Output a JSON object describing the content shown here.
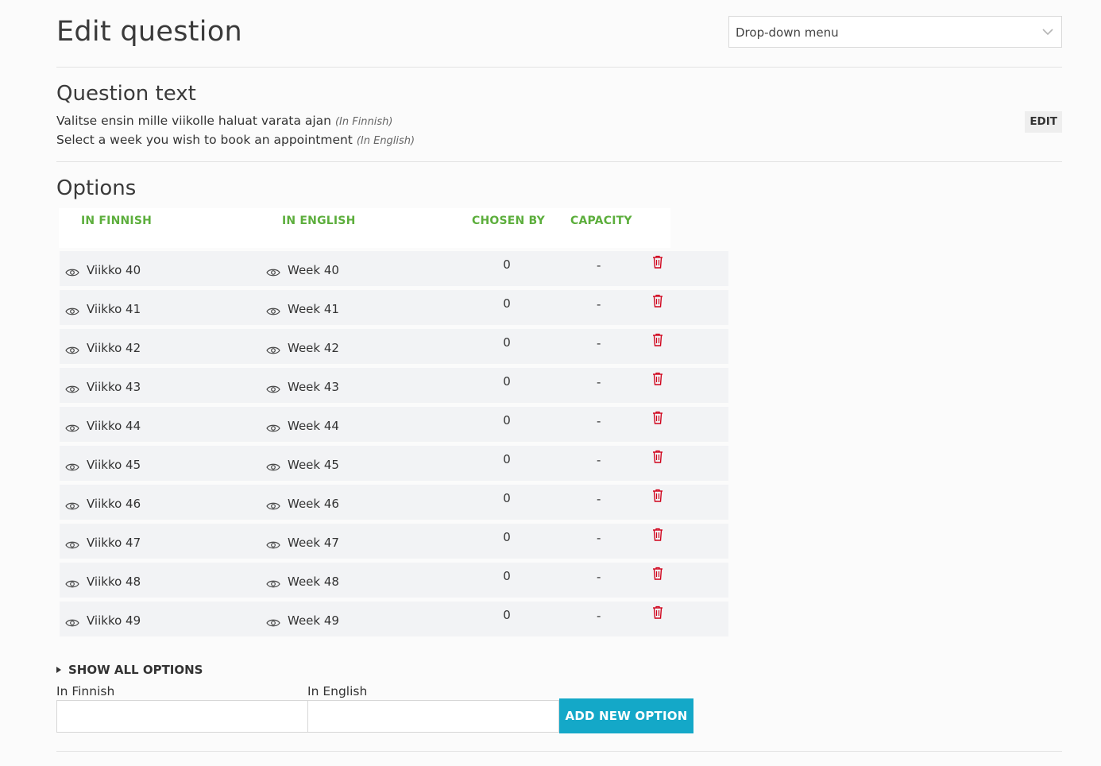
{
  "header": {
    "title": "Edit question",
    "question_type": "Drop-down menu"
  },
  "question_text": {
    "title": "Question text",
    "finnish": "Valitse ensin mille viikolle haluat varata ajan",
    "finnish_tag": "(In Finnish)",
    "english": "Select a week you wish to book an appointment",
    "english_tag": "(In English)",
    "edit_label": "EDIT"
  },
  "options": {
    "title": "Options",
    "columns": {
      "finnish": "IN FINNISH",
      "english": "IN ENGLISH",
      "chosen_by": "CHOSEN BY",
      "capacity": "CAPACITY"
    },
    "rows": [
      {
        "fi": "Viikko 40",
        "en": "Week 40",
        "chosen": "0",
        "capacity": "-"
      },
      {
        "fi": "Viikko 41",
        "en": "Week 41",
        "chosen": "0",
        "capacity": "-"
      },
      {
        "fi": "Viikko 42",
        "en": "Week 42",
        "chosen": "0",
        "capacity": "-"
      },
      {
        "fi": "Viikko 43",
        "en": "Week 43",
        "chosen": "0",
        "capacity": "-"
      },
      {
        "fi": "Viikko 44",
        "en": "Week 44",
        "chosen": "0",
        "capacity": "-"
      },
      {
        "fi": "Viikko 45",
        "en": "Week 45",
        "chosen": "0",
        "capacity": "-"
      },
      {
        "fi": "Viikko 46",
        "en": "Week 46",
        "chosen": "0",
        "capacity": "-"
      },
      {
        "fi": "Viikko 47",
        "en": "Week 47",
        "chosen": "0",
        "capacity": "-"
      },
      {
        "fi": "Viikko 48",
        "en": "Week 48",
        "chosen": "0",
        "capacity": "-"
      },
      {
        "fi": "Viikko 49",
        "en": "Week 49",
        "chosen": "0",
        "capacity": "-"
      }
    ],
    "show_all_label": "SHOW ALL OPTIONS"
  },
  "new_option": {
    "finnish_label": "In Finnish",
    "english_label": "In English",
    "finnish_value": "",
    "english_value": "",
    "add_label": "ADD NEW OPTION"
  },
  "colors": {
    "accent_green": "#5cae3c",
    "button_blue": "#14a8c8",
    "delete_red": "#d0021b"
  },
  "icons": {
    "visibility": "eye-icon",
    "delete": "trash-icon",
    "dropdown": "chevron-down-icon",
    "expand": "caret-right-icon"
  }
}
